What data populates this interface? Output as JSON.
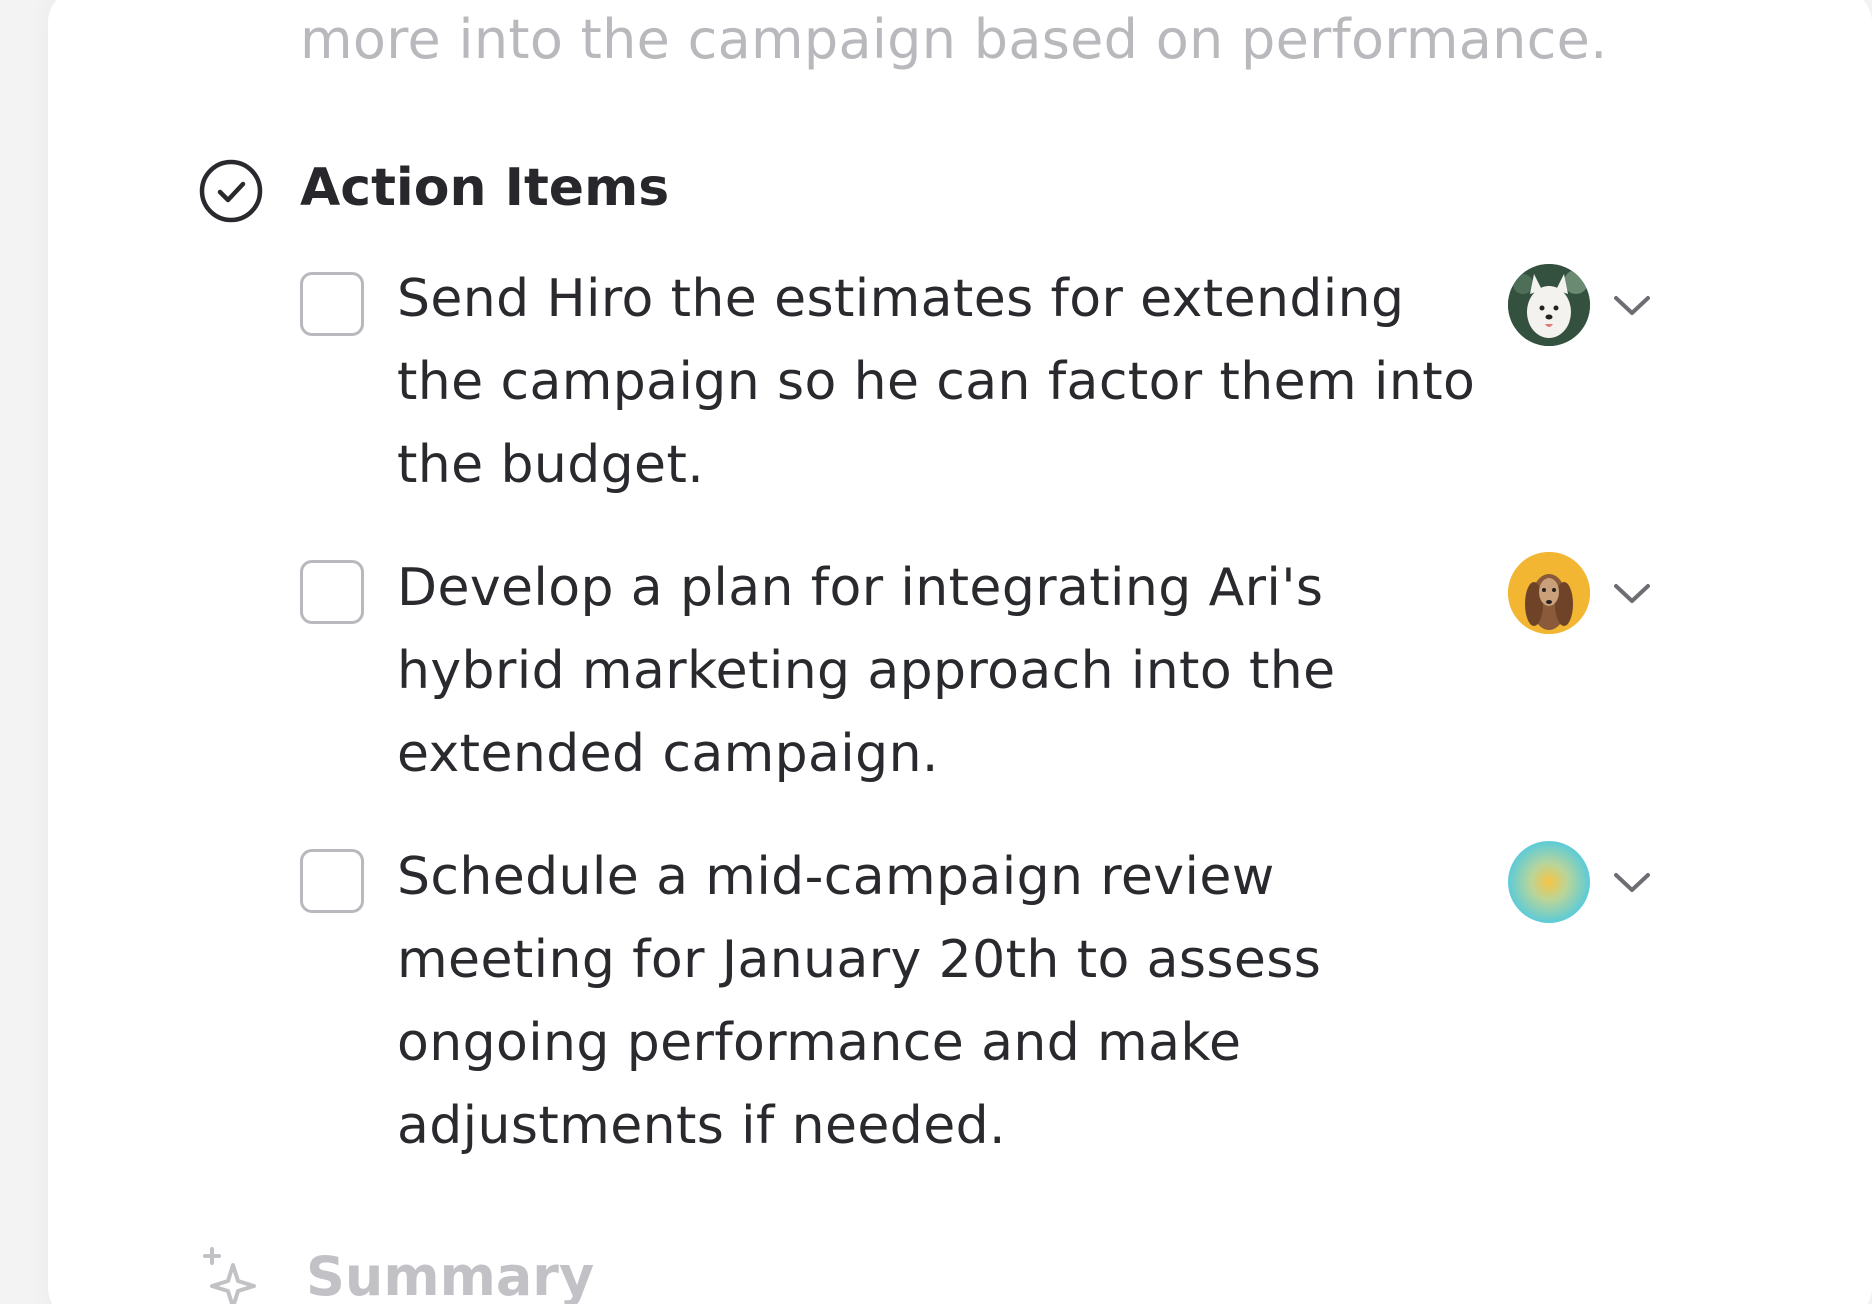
{
  "previous_text": {
    "tail_line": "more into the campaign based on performance."
  },
  "action_items": {
    "icon": "check-circle-icon",
    "title": "Action Items",
    "items": [
      {
        "text": "Send Hiro the estimates for extending the campaign so he can factor them into the budget.",
        "checked": false,
        "avatar": "avatar-white-dog",
        "avatar_bg": "#3a5a48"
      },
      {
        "text": "Develop a plan for integrating Ari's hybrid marketing approach into the extended campaign.",
        "checked": false,
        "avatar": "avatar-brown-dog",
        "avatar_bg": "#f2b632"
      },
      {
        "text": "Schedule a mid-campaign review meeting for January 20th to assess ongoing performance and make adjustments if needed.",
        "checked": false,
        "avatar": "avatar-gradient",
        "avatar_bg": "#6fcfd6"
      }
    ]
  },
  "summary": {
    "icon": "sparkles-icon",
    "title": "Summary"
  }
}
